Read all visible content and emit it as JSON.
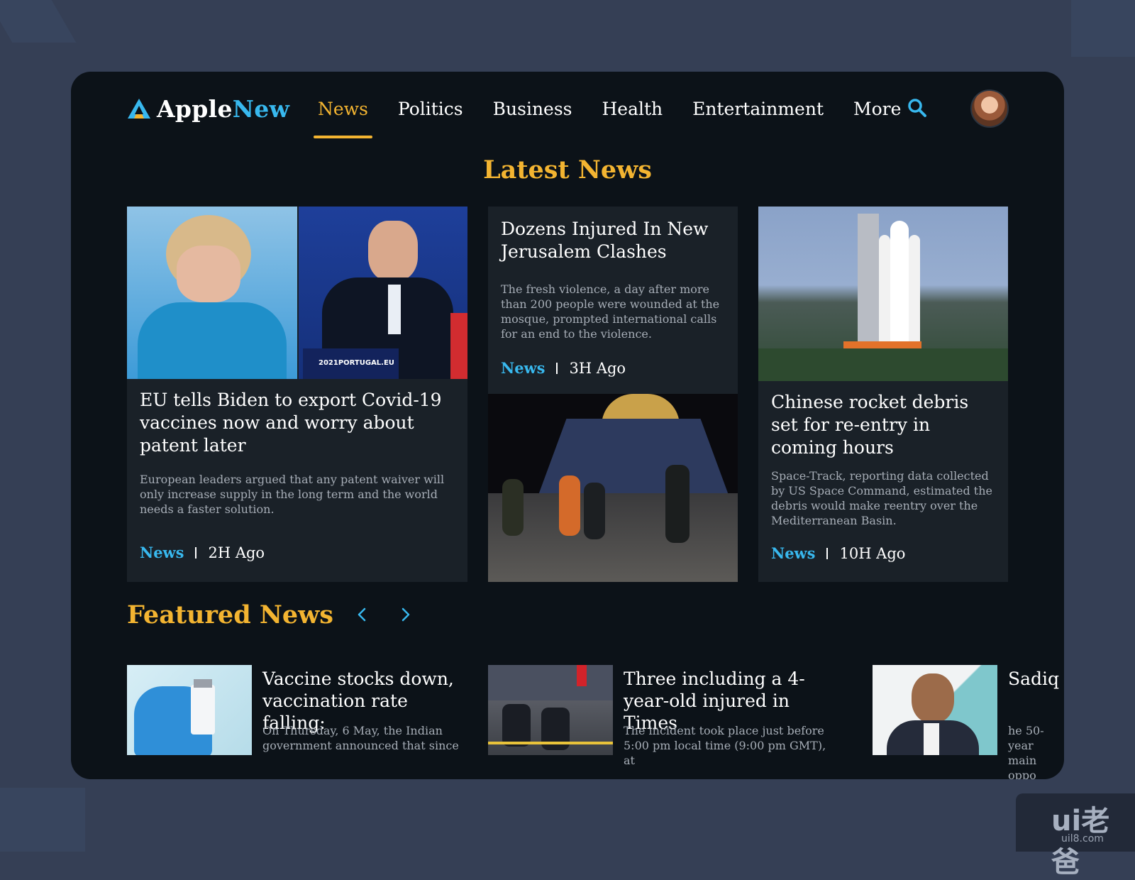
{
  "brand": {
    "name_part1": "Apple",
    "name_part2": "New"
  },
  "nav": {
    "items": [
      "News",
      "Politics",
      "Business",
      "Health",
      "Entertainment",
      "More"
    ],
    "active": "News"
  },
  "latest": {
    "title": "Latest News",
    "articles": [
      {
        "title": "EU tells Biden to export Covid-19 vaccines now and worry about patent later",
        "description": "European leaders argued that any patent waiver will only increase supply in the long term and the world needs a faster solution.",
        "category": "News",
        "time": "2H Ago",
        "image_caption": "2021PORTUGAL.EU"
      },
      {
        "title": "Dozens Injured In New Jerusalem Clashes",
        "description": "The fresh violence, a day after more than 200 people were wounded at the mosque, prompted international calls for an end to the violence.",
        "category": "News",
        "time": "3H Ago"
      },
      {
        "title": "Chinese rocket debris set for re-entry in coming hours",
        "description": "Space-Track, reporting data collected by US Space Command, estimated the debris would make reentry over the Mediterranean Basin.",
        "category": "News",
        "time": "10H Ago"
      }
    ]
  },
  "featured": {
    "title": "Featured News",
    "items": [
      {
        "title": "Vaccine stocks down, vaccination rate falling:",
        "description": "On Thursday, 6 May, the Indian government announced that since"
      },
      {
        "title": "Three including a 4-year-old injured in Times",
        "description": "The incident took place just before 5:00 pm local time (9:00 pm GMT), at"
      },
      {
        "title": "Sadiq Khan: Feisty",
        "description": "he 50-year main oppo"
      }
    ]
  },
  "watermark": {
    "main": "ui老爸",
    "sub": "uil8.com"
  },
  "colors": {
    "accent": "#f3b431",
    "link": "#38b8ee",
    "panel": "#0c1218",
    "card": "#1a2128"
  }
}
